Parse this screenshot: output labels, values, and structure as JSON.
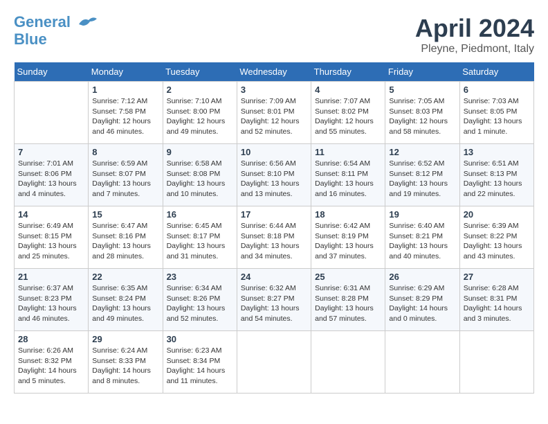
{
  "header": {
    "logo_line1": "General",
    "logo_line2": "Blue",
    "month": "April 2024",
    "location": "Pleyne, Piedmont, Italy"
  },
  "days_of_week": [
    "Sunday",
    "Monday",
    "Tuesday",
    "Wednesday",
    "Thursday",
    "Friday",
    "Saturday"
  ],
  "weeks": [
    [
      {
        "day": "",
        "info": ""
      },
      {
        "day": "1",
        "info": "Sunrise: 7:12 AM\nSunset: 7:58 PM\nDaylight: 12 hours\nand 46 minutes."
      },
      {
        "day": "2",
        "info": "Sunrise: 7:10 AM\nSunset: 8:00 PM\nDaylight: 12 hours\nand 49 minutes."
      },
      {
        "day": "3",
        "info": "Sunrise: 7:09 AM\nSunset: 8:01 PM\nDaylight: 12 hours\nand 52 minutes."
      },
      {
        "day": "4",
        "info": "Sunrise: 7:07 AM\nSunset: 8:02 PM\nDaylight: 12 hours\nand 55 minutes."
      },
      {
        "day": "5",
        "info": "Sunrise: 7:05 AM\nSunset: 8:03 PM\nDaylight: 12 hours\nand 58 minutes."
      },
      {
        "day": "6",
        "info": "Sunrise: 7:03 AM\nSunset: 8:05 PM\nDaylight: 13 hours\nand 1 minute."
      }
    ],
    [
      {
        "day": "7",
        "info": "Sunrise: 7:01 AM\nSunset: 8:06 PM\nDaylight: 13 hours\nand 4 minutes."
      },
      {
        "day": "8",
        "info": "Sunrise: 6:59 AM\nSunset: 8:07 PM\nDaylight: 13 hours\nand 7 minutes."
      },
      {
        "day": "9",
        "info": "Sunrise: 6:58 AM\nSunset: 8:08 PM\nDaylight: 13 hours\nand 10 minutes."
      },
      {
        "day": "10",
        "info": "Sunrise: 6:56 AM\nSunset: 8:10 PM\nDaylight: 13 hours\nand 13 minutes."
      },
      {
        "day": "11",
        "info": "Sunrise: 6:54 AM\nSunset: 8:11 PM\nDaylight: 13 hours\nand 16 minutes."
      },
      {
        "day": "12",
        "info": "Sunrise: 6:52 AM\nSunset: 8:12 PM\nDaylight: 13 hours\nand 19 minutes."
      },
      {
        "day": "13",
        "info": "Sunrise: 6:51 AM\nSunset: 8:13 PM\nDaylight: 13 hours\nand 22 minutes."
      }
    ],
    [
      {
        "day": "14",
        "info": "Sunrise: 6:49 AM\nSunset: 8:15 PM\nDaylight: 13 hours\nand 25 minutes."
      },
      {
        "day": "15",
        "info": "Sunrise: 6:47 AM\nSunset: 8:16 PM\nDaylight: 13 hours\nand 28 minutes."
      },
      {
        "day": "16",
        "info": "Sunrise: 6:45 AM\nSunset: 8:17 PM\nDaylight: 13 hours\nand 31 minutes."
      },
      {
        "day": "17",
        "info": "Sunrise: 6:44 AM\nSunset: 8:18 PM\nDaylight: 13 hours\nand 34 minutes."
      },
      {
        "day": "18",
        "info": "Sunrise: 6:42 AM\nSunset: 8:19 PM\nDaylight: 13 hours\nand 37 minutes."
      },
      {
        "day": "19",
        "info": "Sunrise: 6:40 AM\nSunset: 8:21 PM\nDaylight: 13 hours\nand 40 minutes."
      },
      {
        "day": "20",
        "info": "Sunrise: 6:39 AM\nSunset: 8:22 PM\nDaylight: 13 hours\nand 43 minutes."
      }
    ],
    [
      {
        "day": "21",
        "info": "Sunrise: 6:37 AM\nSunset: 8:23 PM\nDaylight: 13 hours\nand 46 minutes."
      },
      {
        "day": "22",
        "info": "Sunrise: 6:35 AM\nSunset: 8:24 PM\nDaylight: 13 hours\nand 49 minutes."
      },
      {
        "day": "23",
        "info": "Sunrise: 6:34 AM\nSunset: 8:26 PM\nDaylight: 13 hours\nand 52 minutes."
      },
      {
        "day": "24",
        "info": "Sunrise: 6:32 AM\nSunset: 8:27 PM\nDaylight: 13 hours\nand 54 minutes."
      },
      {
        "day": "25",
        "info": "Sunrise: 6:31 AM\nSunset: 8:28 PM\nDaylight: 13 hours\nand 57 minutes."
      },
      {
        "day": "26",
        "info": "Sunrise: 6:29 AM\nSunset: 8:29 PM\nDaylight: 14 hours\nand 0 minutes."
      },
      {
        "day": "27",
        "info": "Sunrise: 6:28 AM\nSunset: 8:31 PM\nDaylight: 14 hours\nand 3 minutes."
      }
    ],
    [
      {
        "day": "28",
        "info": "Sunrise: 6:26 AM\nSunset: 8:32 PM\nDaylight: 14 hours\nand 5 minutes."
      },
      {
        "day": "29",
        "info": "Sunrise: 6:24 AM\nSunset: 8:33 PM\nDaylight: 14 hours\nand 8 minutes."
      },
      {
        "day": "30",
        "info": "Sunrise: 6:23 AM\nSunset: 8:34 PM\nDaylight: 14 hours\nand 11 minutes."
      },
      {
        "day": "",
        "info": ""
      },
      {
        "day": "",
        "info": ""
      },
      {
        "day": "",
        "info": ""
      },
      {
        "day": "",
        "info": ""
      }
    ]
  ]
}
